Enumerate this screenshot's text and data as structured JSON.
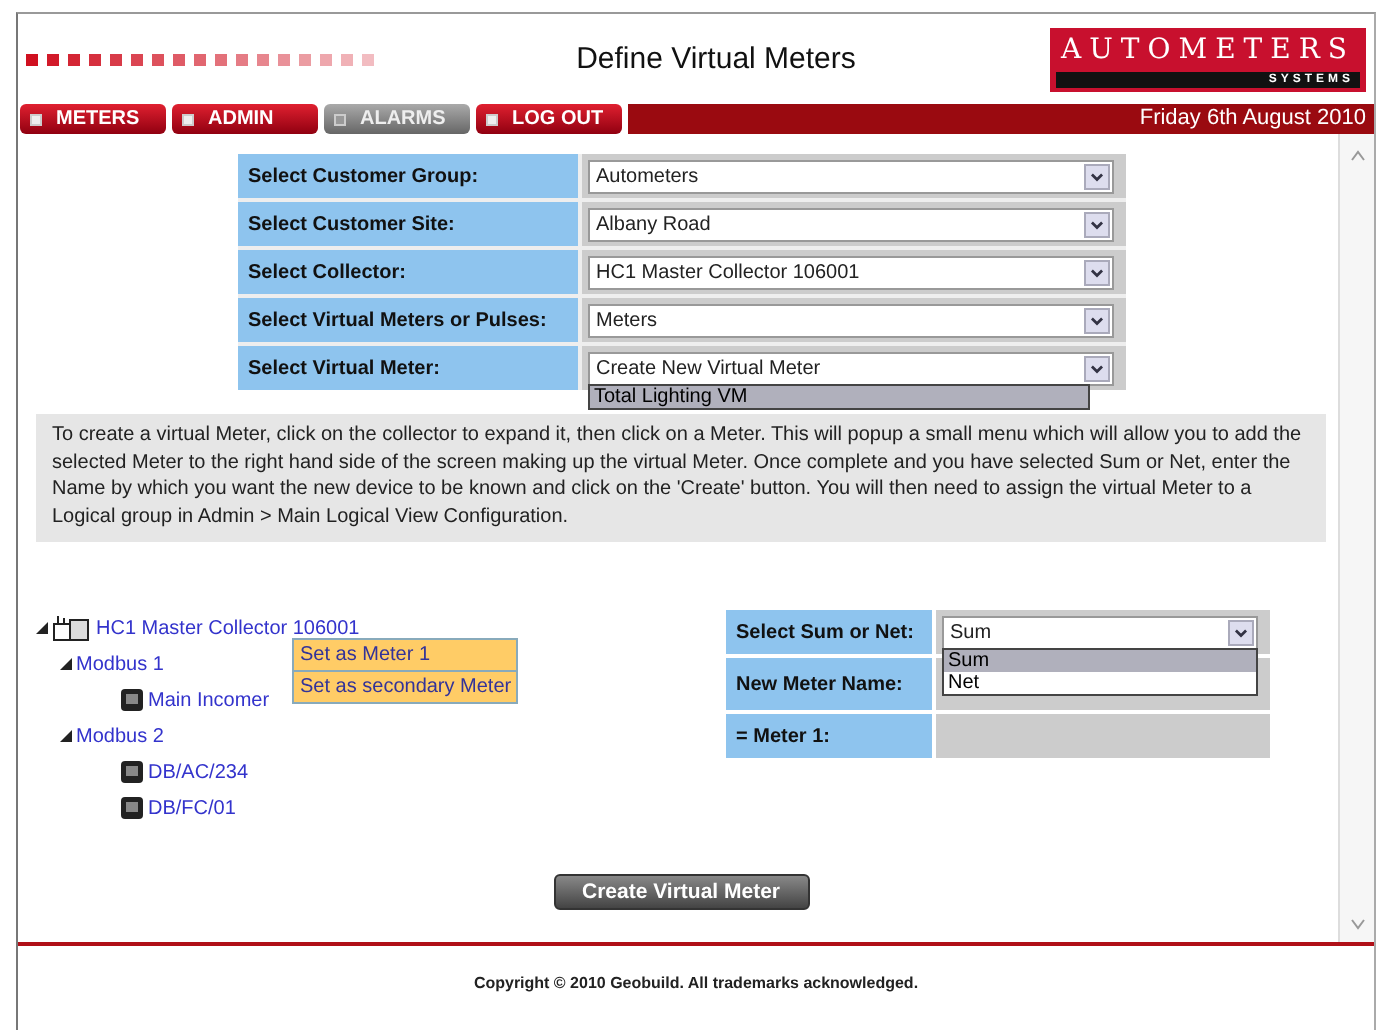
{
  "header": {
    "title": "Define Virtual Meters",
    "logo": {
      "name": "AUTOMETERS",
      "tagline": "SYSTEMS"
    }
  },
  "nav": [
    {
      "label": "METERS",
      "selected": false
    },
    {
      "label": "ADMIN",
      "selected": false
    },
    {
      "label": "ALARMS",
      "selected": true
    },
    {
      "label": "LOG OUT",
      "selected": false
    }
  ],
  "date": "Friday 6th August 2010",
  "selectors": [
    {
      "label": "Select Customer Group:",
      "value": "Autometers"
    },
    {
      "label": "Select Customer Site:",
      "value": "Albany Road"
    },
    {
      "label": "Select Collector:",
      "value": "HC1 Master Collector 106001"
    },
    {
      "label": "Select Virtual Meters or Pulses:",
      "value": "Meters"
    },
    {
      "label": "Select Virtual Meter:",
      "value": "Create New Virtual Meter",
      "options": [
        {
          "label": "Total Lighting VM",
          "selected": true
        }
      ]
    }
  ],
  "instructions": "To create a virtual Meter, click on the collector to expand it, then click on a Meter. This will popup a small menu which will allow you to add the selected Meter to the right hand side of the screen making up the virtual Meter. Once complete and you have selected Sum or Net, enter the Name by which you want the new device to be known and click on the 'Create' button. You will then need to assign the virtual Meter to a Logical group in Admin > Main Logical View Configuration.",
  "tree": [
    {
      "label": "HC1 Master Collector 106001",
      "kind": "collector",
      "expanded": true,
      "children": [
        {
          "label": "Modbus 1",
          "expanded": true,
          "children": [
            {
              "label": "Main Incomer",
              "kind": "meter"
            }
          ]
        },
        {
          "label": "Modbus 2",
          "expanded": true,
          "children": [
            {
              "label": "DB/AC/234",
              "kind": "meter"
            },
            {
              "label": "DB/FC/01",
              "kind": "meter"
            }
          ]
        }
      ]
    }
  ],
  "popup_menu": [
    "Set as Meter 1",
    "Set as secondary Meter"
  ],
  "virtual_meter_form": {
    "sum_or_net": {
      "label": "Select Sum or Net:",
      "value": "Sum",
      "options": [
        {
          "label": "Sum",
          "selected": true
        },
        {
          "label": "Net",
          "selected": false
        }
      ]
    },
    "name_label": "New Meter Name:",
    "meter_1_label": "= Meter 1:"
  },
  "create_button": "Create Virtual Meter",
  "footer": "Copyright © 2010 Geobuild. All trademarks acknowledged."
}
